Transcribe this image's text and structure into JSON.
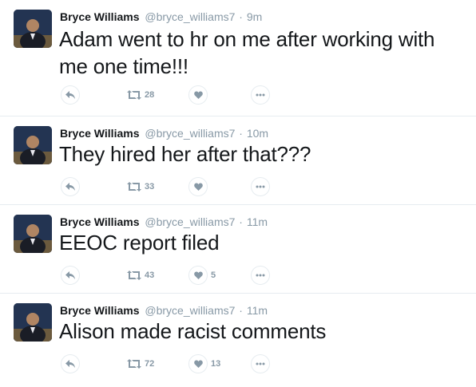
{
  "tweets": [
    {
      "name": "Bryce Williams",
      "handle": "@bryce_williams7",
      "separator": "·",
      "time": "9m",
      "text": "Adam went to hr on me after working with me one time!!!",
      "retweets": "28",
      "likes": ""
    },
    {
      "name": "Bryce Williams",
      "handle": "@bryce_williams7",
      "separator": "·",
      "time": "10m",
      "text": "They hired her after that???",
      "retweets": "33",
      "likes": ""
    },
    {
      "name": "Bryce Williams",
      "handle": "@bryce_williams7",
      "separator": "·",
      "time": "11m",
      "text": "EEOC report filed",
      "retweets": "43",
      "likes": "5"
    },
    {
      "name": "Bryce Williams",
      "handle": "@bryce_williams7",
      "separator": "·",
      "time": "11m",
      "text": "Alison made racist comments",
      "retweets": "72",
      "likes": "13"
    }
  ],
  "icons": {
    "reply": "reply-icon",
    "retweet": "retweet-icon",
    "like": "heart-icon",
    "more": "more-icon"
  },
  "colors": {
    "text": "#14171a",
    "muted": "#8899a6",
    "border": "#e6ecf0"
  }
}
